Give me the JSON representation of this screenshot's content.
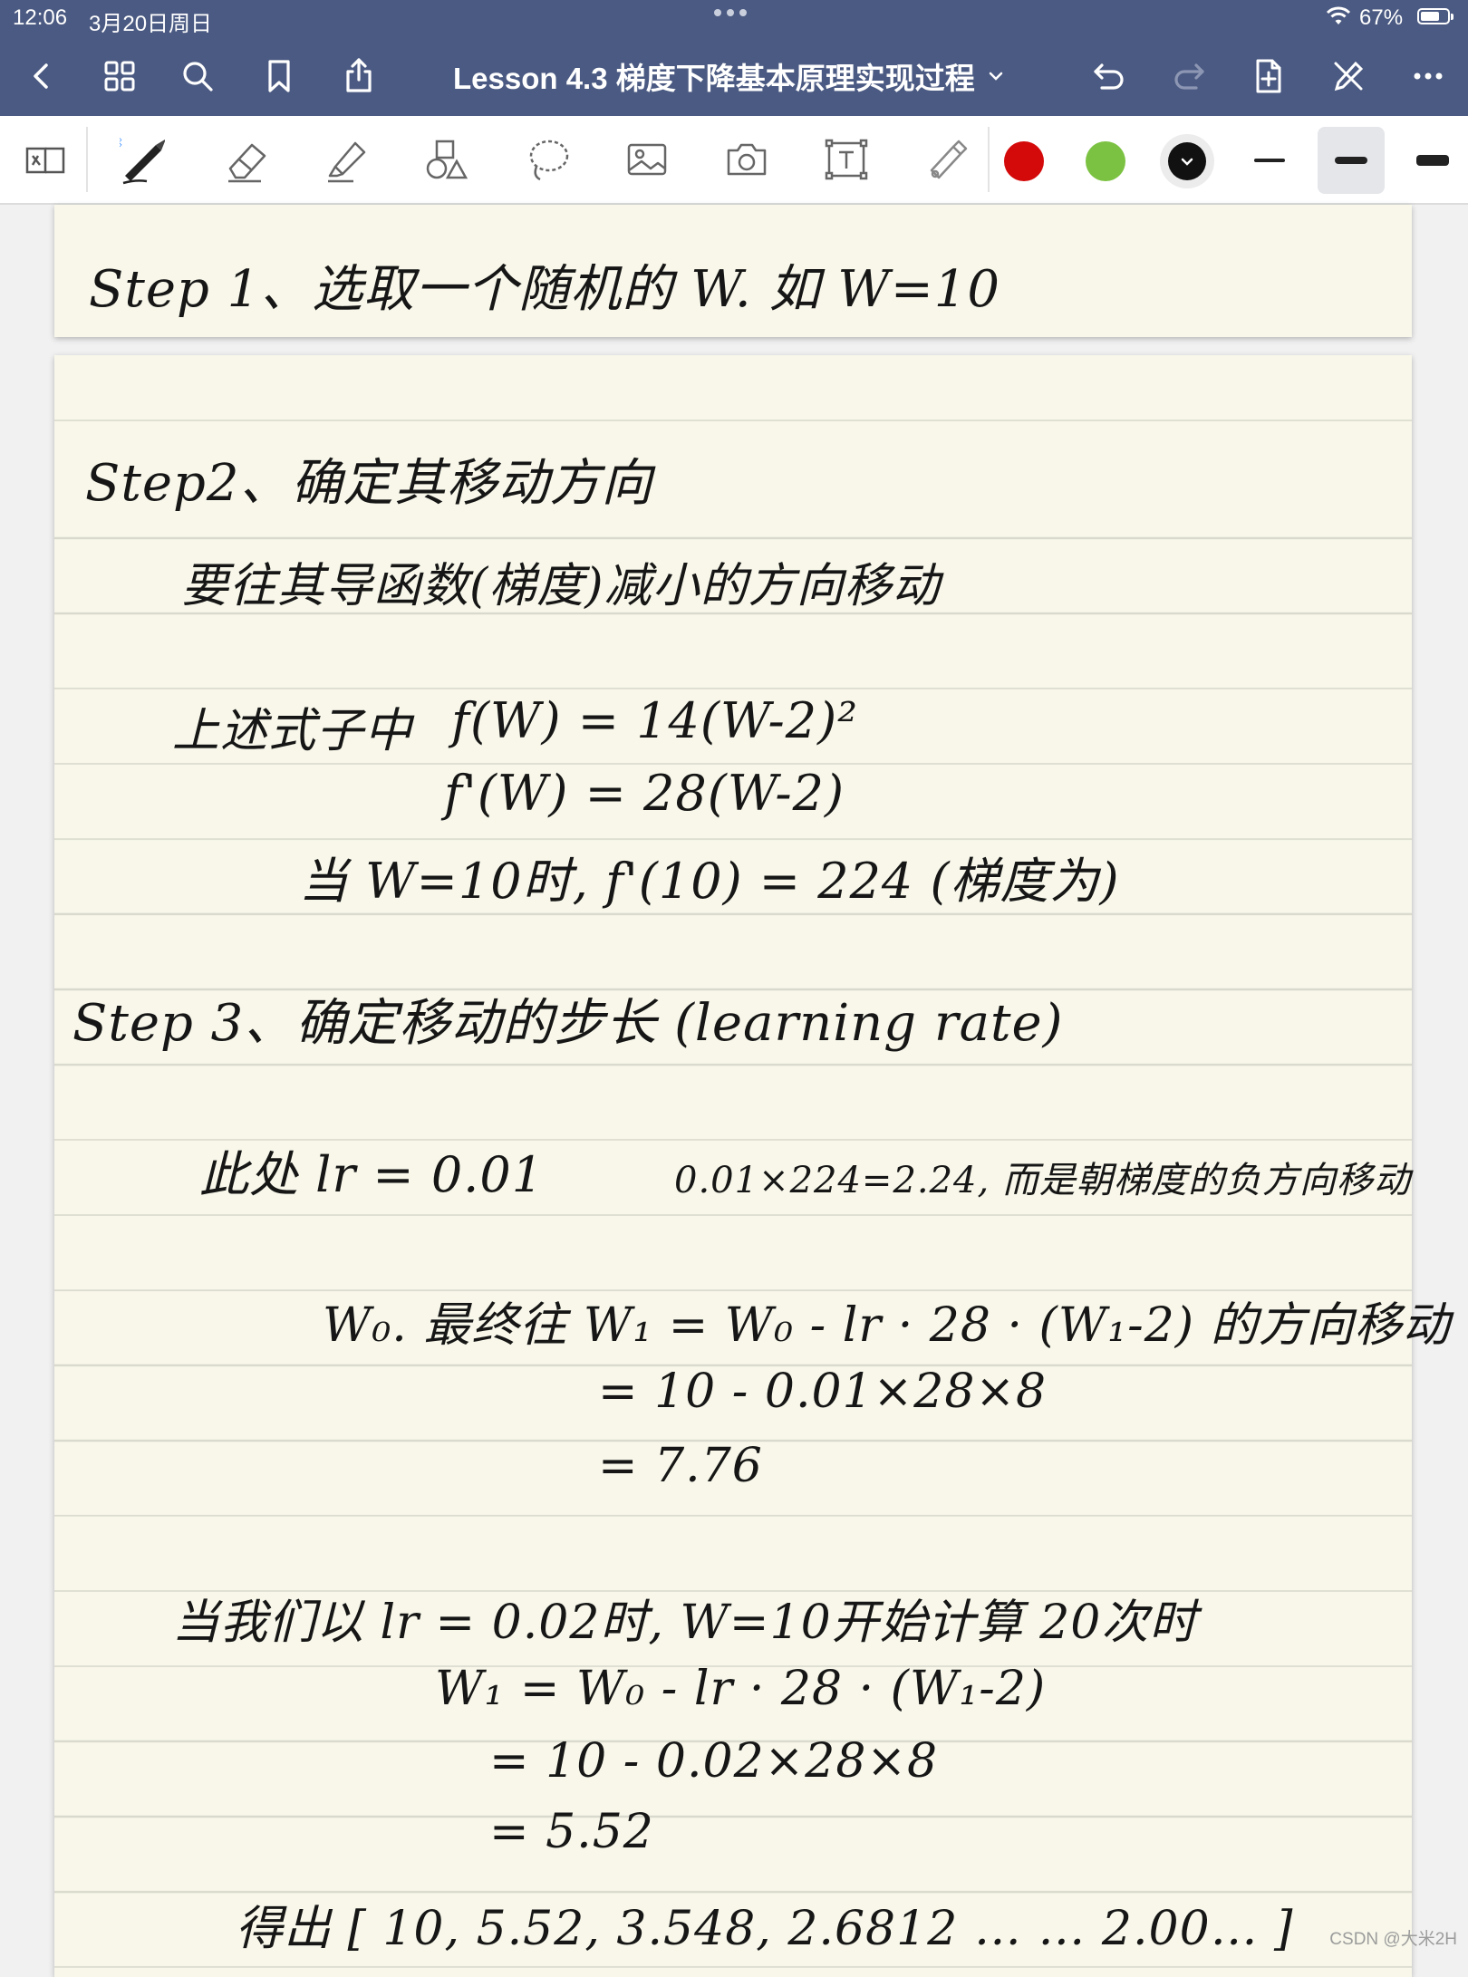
{
  "status_bar": {
    "time": "12:06",
    "date": "3月20日周日",
    "battery": "67%"
  },
  "nav": {
    "doc_title": "Lesson 4.3 梯度下降基本原理实现过程"
  },
  "toolbar": {
    "colors": [
      "#d40a0a",
      "#7cc242",
      "#111111"
    ],
    "selected_color_index": 2,
    "selected_stroke_index": 1
  },
  "note": {
    "page1": {
      "step1": "Step 1、选取一个随机的 W. 如 W=10"
    },
    "page2": {
      "step2_title": "Step2、确定其移动方向",
      "step2_desc": "要往其导函数(梯度)减小的方向移动",
      "formula_label": "上述式子中",
      "formula_f": "f(W) = 14(W-2)²",
      "formula_fprime": "f'(W) = 28(W-2)",
      "gradient_line": "当 W=10时, f'(10) = 224 (梯度为)",
      "step3_title": "Step 3、确定移动的步长 (learning rate)",
      "lr_here": "此处 lr = 0.01",
      "lr_note": "0.01×224=2.24, 而是朝梯度的负方向移动",
      "update_rule": "W₀. 最终往 W₁ = W₀ - lr · 28 · (W₁-2) 的方向移动",
      "update_calc1": "= 10 - 0.01×28×8",
      "update_calc2": "= 7.76",
      "iter_intro": "当我们以 lr = 0.02时, W=10开始计算 20次时",
      "iter_rule": "W₁ = W₀ - lr · 28 · (W₁-2)",
      "iter_calc1": "= 10 - 0.02×28×8",
      "iter_calc2": "= 5.52",
      "result": "得出 [ 10, 5.52, 3.548, 2.6812 … … 2.00… ]"
    }
  },
  "watermark": "CSDN @大米2H"
}
